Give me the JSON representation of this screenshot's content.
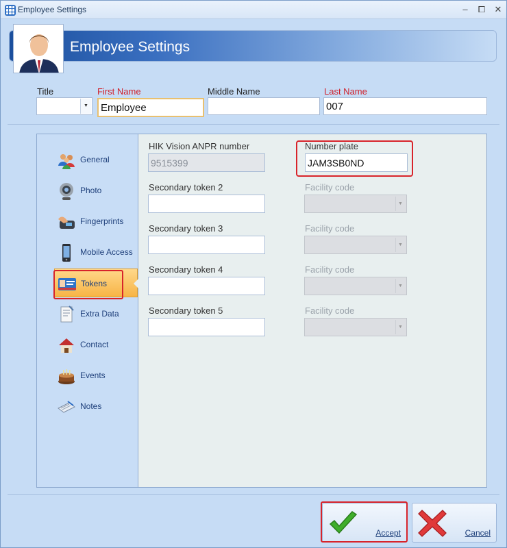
{
  "window": {
    "title": "Employee Settings",
    "controls": {
      "minimize": "–",
      "restore": "⧠",
      "close": "✕"
    }
  },
  "header": {
    "title": "Employee Settings"
  },
  "name_fields": {
    "title_label": "Title",
    "title_value": "",
    "first_name_label": "First Name",
    "first_name_value": "Employee",
    "middle_name_label": "Middle Name",
    "middle_name_value": "",
    "last_name_label": "Last Name",
    "last_name_value": "007"
  },
  "sidebar": {
    "items": [
      {
        "label": "General",
        "icon": "people-icon"
      },
      {
        "label": "Photo",
        "icon": "webcam-icon"
      },
      {
        "label": "Fingerprints",
        "icon": "fingerprint-reader-icon"
      },
      {
        "label": "Mobile Access",
        "icon": "mobile-phone-icon"
      },
      {
        "label": "Tokens",
        "icon": "id-card-icon",
        "active": true
      },
      {
        "label": "Extra Data",
        "icon": "notepad-icon"
      },
      {
        "label": "Contact",
        "icon": "house-icon"
      },
      {
        "label": "Events",
        "icon": "cake-icon"
      },
      {
        "label": "Notes",
        "icon": "notebook-icon"
      }
    ]
  },
  "tokens": {
    "anpr_label": "HIK Vision ANPR number",
    "anpr_value": "9515399",
    "plate_label": "Number plate",
    "plate_value": "JAM3SB0ND",
    "secondary": [
      {
        "label": "Secondary token 2",
        "value": "",
        "facility_label": "Facility code",
        "facility_value": ""
      },
      {
        "label": "Secondary token 3",
        "value": "",
        "facility_label": "Facility code",
        "facility_value": ""
      },
      {
        "label": "Secondary token 4",
        "value": "",
        "facility_label": "Facility code",
        "facility_value": ""
      },
      {
        "label": "Secondary token 5",
        "value": "",
        "facility_label": "Facility code",
        "facility_value": ""
      }
    ]
  },
  "buttons": {
    "accept": "Accept",
    "cancel": "Cancel"
  },
  "colors": {
    "highlight": "#d8232a",
    "required": "#d0202a",
    "active_tab": "#f7b446"
  }
}
